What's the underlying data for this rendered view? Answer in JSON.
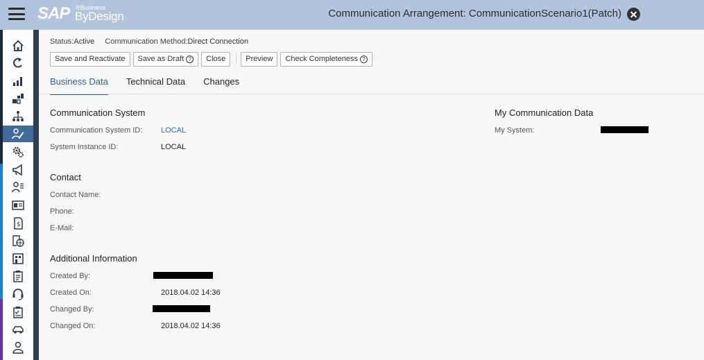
{
  "header": {
    "logo_sap": "SAP",
    "logo_business": "®Business",
    "logo_bydesign": "ByDesign",
    "title": "Communication Arrangement: CommunicationScenario1(Patch)"
  },
  "status": {
    "status_label": "Status:",
    "status_value": "Active",
    "method_label": "Communication Method:",
    "method_value": "Direct Connection"
  },
  "toolbar": {
    "save_reactivate": "Save and Reactivate",
    "save_draft": "Save as Draft",
    "close": "Close",
    "preview": "Preview",
    "check_completeness": "Check Completeness"
  },
  "tabs": [
    "Business Data",
    "Technical Data",
    "Changes"
  ],
  "communication_system": {
    "title": "Communication System",
    "system_id_label": "Communication System ID:",
    "system_id_value": "LOCAL",
    "instance_id_label": "System Instance ID:",
    "instance_id_value": "LOCAL"
  },
  "contact": {
    "title": "Contact",
    "name_label": "Contact Name:",
    "phone_label": "Phone:",
    "email_label": "E-Mail:"
  },
  "additional": {
    "title": "Additional Information",
    "created_by_label": "Created By:",
    "created_on_label": "Created On:",
    "created_on_value": "2018.04.02 14:36",
    "changed_by_label": "Changed By:",
    "changed_on_label": "Changed On:",
    "changed_on_value": "2018.04.02 14:36"
  },
  "my_comm_data": {
    "title": "My Communication Data",
    "my_system_label": "My System:"
  },
  "sidebar_icons": [
    "home-icon",
    "refresh-icon",
    "bar-chart-icon",
    "org-chart-icon",
    "hierarchy-icon",
    "user-edit-icon",
    "gears-icon",
    "megaphone-icon",
    "user-list-icon",
    "id-card-icon",
    "price-document-icon",
    "globe-document-icon",
    "building-icon",
    "clipboard-icon",
    "headset-icon",
    "checklist-icon",
    "car-icon",
    "person-icon"
  ]
}
